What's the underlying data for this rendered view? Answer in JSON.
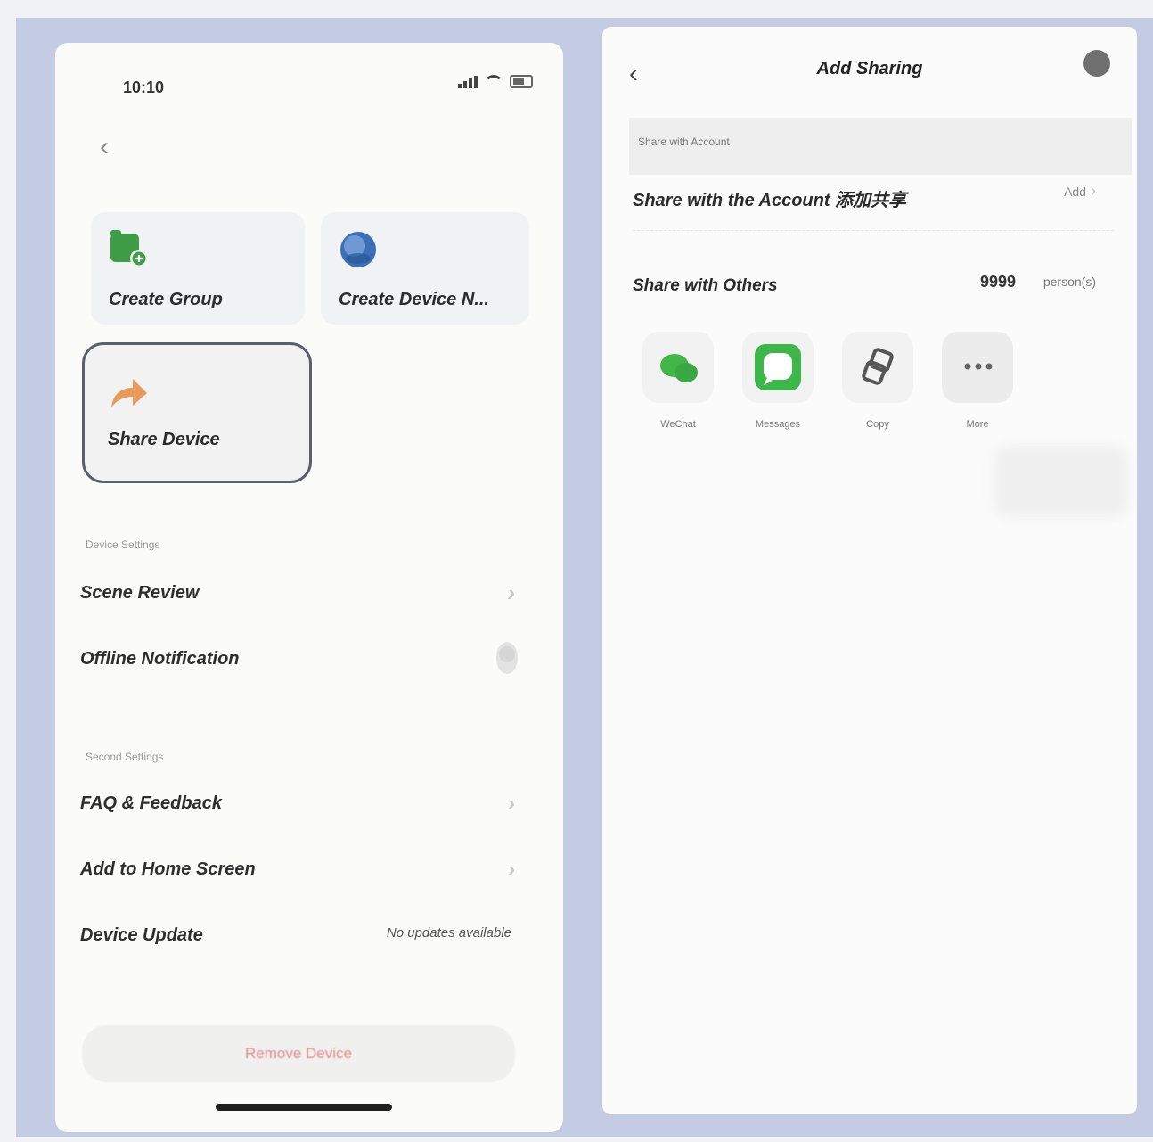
{
  "left_screen": {
    "status": {
      "time": "10:10"
    },
    "header_left": "",
    "header_right": "",
    "actions": [
      {
        "label": "Create Group",
        "icon": "group-icon",
        "color": "#3f9c47"
      },
      {
        "label": "Create Device N...",
        "icon": "globe-icon",
        "color": "#3d6fb6"
      },
      {
        "label": "Share Device",
        "icon": "share-arrow-icon",
        "color": "#e89a5b"
      }
    ],
    "sections": [
      {
        "title": "Device Settings",
        "rows": [
          {
            "label": "Scene Review",
            "value": ""
          },
          {
            "label": "Offline Notification",
            "value": ""
          }
        ]
      },
      {
        "title": "Second Settings",
        "rows": [
          {
            "label": "FAQ & Feedback",
            "value": ""
          },
          {
            "label": "Add to Home Screen",
            "value": ""
          },
          {
            "label": "Device Update",
            "value": "No updates available"
          }
        ]
      }
    ],
    "remove_button": "Remove Device"
  },
  "right_screen": {
    "title": "Add Sharing",
    "strip_label": "Share with Account",
    "account_row": {
      "label": "Share with the Account 添加共享",
      "action": "Add"
    },
    "others_row": {
      "label": "Share with Others",
      "count": "9999",
      "unit": "person(s)"
    },
    "share_options": [
      {
        "label": "WeChat",
        "icon": "wechat-icon",
        "color": "#43b649"
      },
      {
        "label": "Messages",
        "icon": "messages-icon",
        "color": "#3db64a"
      },
      {
        "label": "Copy",
        "icon": "copy-icon",
        "color": "#555555"
      },
      {
        "label": "More",
        "icon": "more-icon",
        "color": "#666666"
      }
    ]
  }
}
